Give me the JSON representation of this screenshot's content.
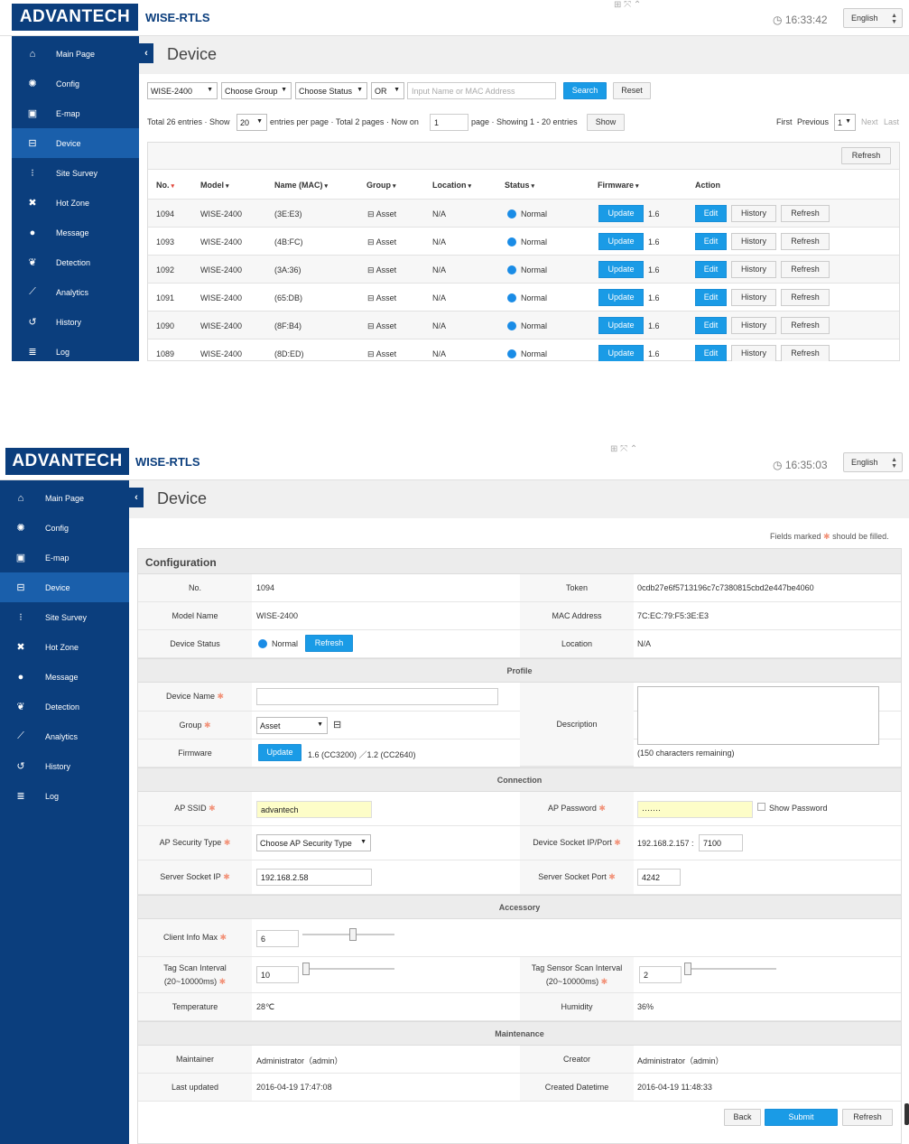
{
  "brand": {
    "logo": "ADVANTECH",
    "product": "WISE-RTLS"
  },
  "language": "English",
  "nav": [
    {
      "label": "Main Page",
      "icon": "home-icon",
      "glyph": "⌂"
    },
    {
      "label": "Config",
      "icon": "gear-icon",
      "glyph": "✺"
    },
    {
      "label": "E-map",
      "icon": "image-icon",
      "glyph": "▣"
    },
    {
      "label": "Device",
      "icon": "device-icon",
      "glyph": "⊟"
    },
    {
      "label": "Site Survey",
      "icon": "signal-icon",
      "glyph": "⁝"
    },
    {
      "label": "Hot Zone",
      "icon": "arrows-icon",
      "glyph": "✖"
    },
    {
      "label": "Message",
      "icon": "chat-icon",
      "glyph": "●"
    },
    {
      "label": "Detection",
      "icon": "leaf-icon",
      "glyph": "❦"
    },
    {
      "label": "Analytics",
      "icon": "chart-line-icon",
      "glyph": "⟋"
    },
    {
      "label": "History",
      "icon": "history-icon",
      "glyph": "↺"
    },
    {
      "label": "Log",
      "icon": "list-icon",
      "glyph": "≣"
    }
  ],
  "list_view": {
    "time": "16:33:42",
    "title": "Device",
    "filters": {
      "model": "WISE-2400",
      "group": "Choose Group",
      "status": "Choose Status",
      "logic": "OR",
      "search_placeholder": "Input Name or MAC Address",
      "search_button": "Search",
      "reset_button": "Reset"
    },
    "pagination": {
      "total_prefix": "Total 26 entries · Show",
      "per_page": "20",
      "mid_text": "entries per page · Total 2 pages · Now on",
      "page": "1",
      "showing": "page · Showing 1 - 20 entries",
      "show_button": "Show",
      "first": "First",
      "previous": "Previous",
      "page_select": "1",
      "next": "Next",
      "last": "Last"
    },
    "refresh_button": "Refresh",
    "columns": [
      "No.",
      "Model",
      "Name (MAC)",
      "Group",
      "Location",
      "Status",
      "Firmware",
      "Action"
    ],
    "rows": [
      {
        "no": "1094",
        "model": "WISE-2400",
        "name": "(3E:E3)",
        "group": "Asset",
        "location": "N/A",
        "status": "Normal",
        "firmware": "1.6"
      },
      {
        "no": "1093",
        "model": "WISE-2400",
        "name": "(4B:FC)",
        "group": "Asset",
        "location": "N/A",
        "status": "Normal",
        "firmware": "1.6"
      },
      {
        "no": "1092",
        "model": "WISE-2400",
        "name": "(3A:36)",
        "group": "Asset",
        "location": "N/A",
        "status": "Normal",
        "firmware": "1.6"
      },
      {
        "no": "1091",
        "model": "WISE-2400",
        "name": "(65:DB)",
        "group": "Asset",
        "location": "N/A",
        "status": "Normal",
        "firmware": "1.6"
      },
      {
        "no": "1090",
        "model": "WISE-2400",
        "name": "(8F:B4)",
        "group": "Asset",
        "location": "N/A",
        "status": "Normal",
        "firmware": "1.6"
      },
      {
        "no": "1089",
        "model": "WISE-2400",
        "name": "(8D:ED)",
        "group": "Asset",
        "location": "N/A",
        "status": "Normal",
        "firmware": "1.6"
      }
    ],
    "row_buttons": {
      "update": "Update",
      "edit": "Edit",
      "history": "History",
      "refresh": "Refresh"
    }
  },
  "detail_view": {
    "time": "16:35:03",
    "title": "Device",
    "note_prefix": "Fields marked",
    "note_suffix": "should be filled.",
    "configuration": "Configuration",
    "config": {
      "no_label": "No.",
      "no": "1094",
      "token_label": "Token",
      "token": "0cdb27e6f5713196c7c7380815cbd2e447be4060",
      "model_label": "Model Name",
      "model": "WISE-2400",
      "mac_label": "MAC Address",
      "mac": "7C:EC:79:F5:3E:E3",
      "status_label": "Device Status",
      "status": "Normal",
      "status_refresh": "Refresh",
      "location_label": "Location",
      "location": "N/A"
    },
    "profile": {
      "head": "Profile",
      "device_name_label": "Device Name",
      "device_name": "",
      "group_label": "Group",
      "group": "Asset",
      "firmware_label": "Firmware",
      "update_button": "Update",
      "firmware": "1.6 (CC3200) ／1.2 (CC2640)",
      "description_label": "Description",
      "chars_remaining": "(150 characters remaining)"
    },
    "connection": {
      "head": "Connection",
      "ssid_label": "AP SSID",
      "ssid": "advantech",
      "password_label": "AP Password",
      "password": "·······",
      "show_password": "Show Password",
      "security_label": "AP Security Type",
      "security": "Choose AP Security Type",
      "socket_label": "Device Socket IP/Port",
      "socket_ip": "192.168.2.157 :",
      "socket_port": "7100",
      "server_ip_label": "Server Socket IP",
      "server_ip": "192.168.2.58",
      "server_port_label": "Server Socket Port",
      "server_port": "4242"
    },
    "accessory": {
      "head": "Accessory",
      "client_max_label": "Client Info Max",
      "client_max": "6",
      "tag_scan_label_1": "Tag Scan Interval",
      "tag_scan_label_2": "(20~10000ms)",
      "tag_scan": "10",
      "sensor_scan_label_1": "Tag Sensor Scan Interval",
      "sensor_scan_label_2": "(20~10000ms)",
      "sensor_scan": "2",
      "temperature_label": "Temperature",
      "temperature": "28℃",
      "humidity_label": "Humidity",
      "humidity": "36%"
    },
    "maintenance": {
      "head": "Maintenance",
      "maintainer_label": "Maintainer",
      "maintainer": "Administrator（admin）",
      "creator_label": "Creator",
      "creator": "Administrator（admin）",
      "updated_label": "Last updated",
      "updated": "2016-04-19 17:47:08",
      "created_label": "Created Datetime",
      "created": "2016-04-19 11:48:33"
    },
    "buttons": {
      "back": "Back",
      "submit": "Submit",
      "refresh": "Refresh"
    }
  }
}
